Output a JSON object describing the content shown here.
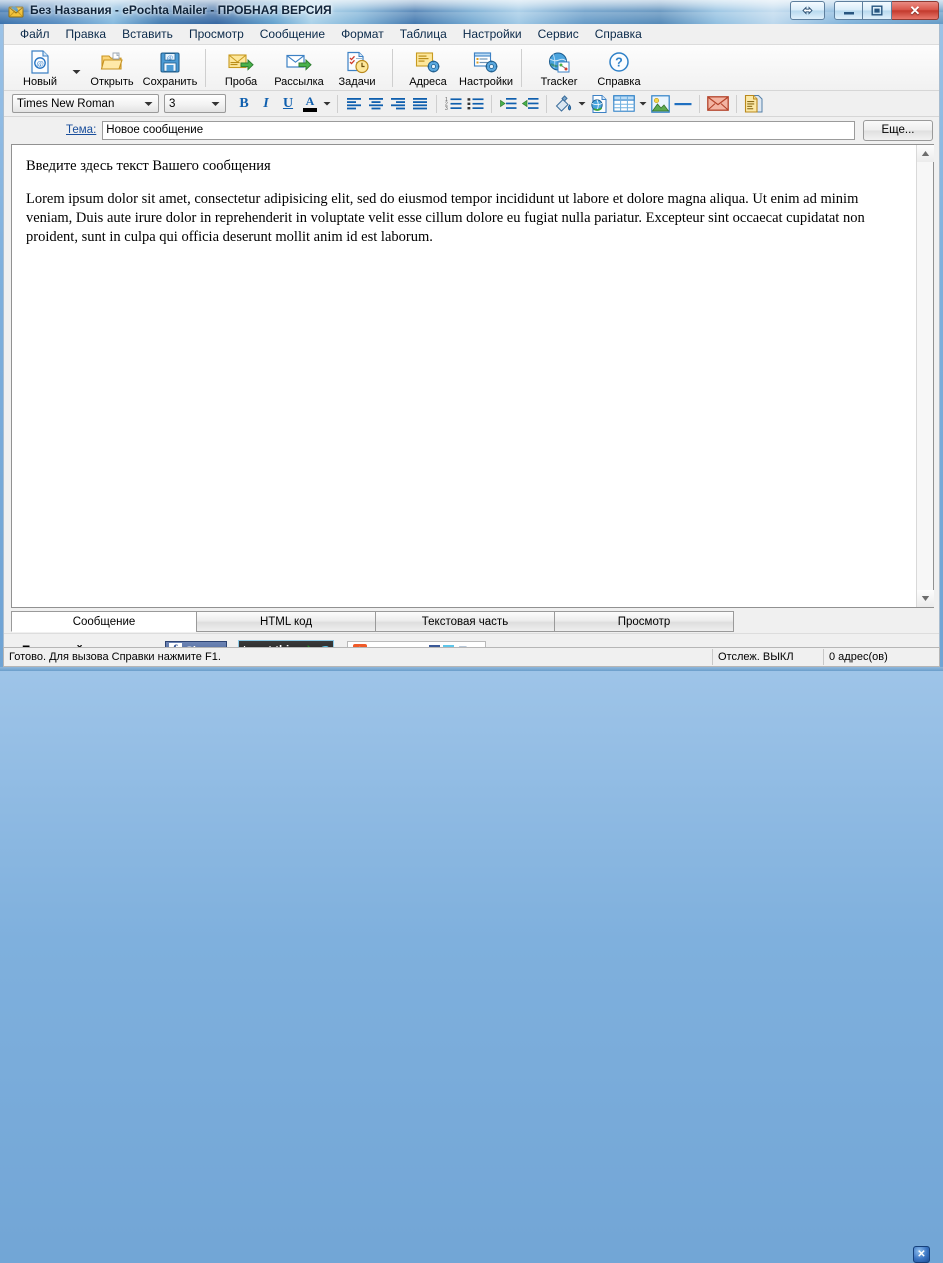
{
  "window": {
    "title": "Без Названия - ePochta Mailer - ПРОБНАЯ ВЕРСИЯ",
    "icon": "mail-envelope-icon",
    "controls": {
      "resize": "⇔",
      "minimize": "—",
      "maximize": "❐",
      "close": "✕"
    }
  },
  "menubar": {
    "items": [
      {
        "label": "Файл"
      },
      {
        "label": "Правка"
      },
      {
        "label": "Вставить"
      },
      {
        "label": "Просмотр"
      },
      {
        "label": "Сообщение"
      },
      {
        "label": "Формат"
      },
      {
        "label": "Таблица"
      },
      {
        "label": "Настройки"
      },
      {
        "label": "Сервис"
      },
      {
        "label": "Справка"
      }
    ]
  },
  "toolbar": {
    "buttons": [
      {
        "label": "Новый",
        "icon": "new-document-icon",
        "has_dropdown": true
      },
      {
        "label": "Открыть",
        "icon": "open-folder-icon"
      },
      {
        "label": "Сохранить",
        "icon": "save-floppy-icon"
      },
      {
        "label": "Проба",
        "icon": "test-send-icon"
      },
      {
        "label": "Рассылка",
        "icon": "send-mail-icon"
      },
      {
        "label": "Задачи",
        "icon": "tasks-clock-icon"
      },
      {
        "label": "Адреса",
        "icon": "addresses-gear-icon"
      },
      {
        "label": "Настройки",
        "icon": "settings-gear-icon"
      },
      {
        "label": "Tracker",
        "icon": "tracker-globe-icon"
      },
      {
        "label": "Справка",
        "icon": "help-question-icon"
      }
    ]
  },
  "format_toolbar": {
    "font_family": "Times New Roman",
    "font_size": "3",
    "buttons": [
      {
        "name": "bold",
        "glyph": "B"
      },
      {
        "name": "italic",
        "glyph": "I"
      },
      {
        "name": "underline",
        "glyph": "U"
      },
      {
        "name": "font-color",
        "glyph": "A"
      },
      {
        "name": "align-left"
      },
      {
        "name": "align-center"
      },
      {
        "name": "align-right"
      },
      {
        "name": "align-justify"
      },
      {
        "name": "ordered-list"
      },
      {
        "name": "unordered-list"
      },
      {
        "name": "outdent"
      },
      {
        "name": "indent"
      },
      {
        "name": "background-color"
      },
      {
        "name": "insert-link"
      },
      {
        "name": "insert-table"
      },
      {
        "name": "insert-image"
      },
      {
        "name": "horizontal-rule"
      },
      {
        "name": "insert-email"
      },
      {
        "name": "insert-template"
      }
    ]
  },
  "subject": {
    "label": "Тема:",
    "value": "Новое сообщение",
    "placeholder": "",
    "more_button": "Еще..."
  },
  "editor": {
    "heading": "Введите здесь текст Вашего сообщения",
    "body": "Lorem ipsum dolor sit amet, consectetur adipisicing elit, sed do eiusmod tempor incididunt ut labore et dolore magna aliqua. Ut enim ad minim veniam, Duis aute irure dolor in reprehenderit in voluptate velit esse cillum dolore eu fugiat nulla pariatur. Excepteur sint occaecat cupidatat non proident, sunt in culpa qui officia deserunt mollit anim id est laborum."
  },
  "tabs": [
    {
      "label": "Сообщение",
      "active": true
    },
    {
      "label": "HTML код",
      "active": false
    },
    {
      "label": "Текстовая часть",
      "active": false
    },
    {
      "label": "Просмотр",
      "active": false
    }
  ],
  "share": {
    "label": "Посоветуйте друзьям:",
    "facebook": {
      "glyph": "f",
      "label": "Share"
    },
    "twitter": {
      "label": "tweet this"
    },
    "addthis": {
      "plus": "+",
      "label": "SHARE",
      "fb": "f",
      "tw": "t",
      "mail": "✉",
      "more": "..."
    },
    "close_badge": "✕"
  },
  "statusbar": {
    "message": "Готово. Для вызова Справки нажмите F1.",
    "tracking": "Отслеж. ВЫКЛ",
    "addresses": "0 адрес(ов)"
  },
  "colors": {
    "title_accent": "#2f6aa8",
    "link": "#1b4f9c",
    "close_red": "#c33a2d",
    "facebook_blue": "#3b5998",
    "addthis_orange": "#f05a28",
    "icon_blue": "#1f6fc0",
    "icon_gold": "#f0b428",
    "icon_green": "#3aa33a"
  }
}
